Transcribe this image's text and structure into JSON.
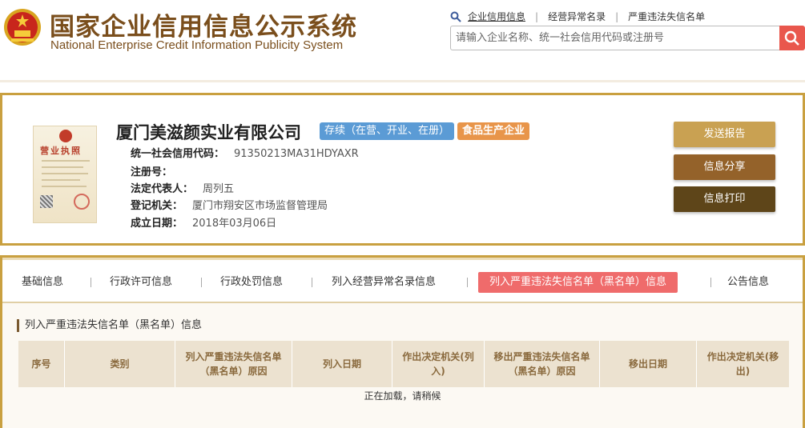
{
  "header": {
    "title_cn": "国家企业信用信息公示系统",
    "title_en": "National Enterprise Credit Information Publicity System",
    "links": [
      "企业信用信息",
      "经营异常名录",
      "严重违法失信名单"
    ],
    "search_placeholder": "请输入企业名称、统一社会信用代码或注册号"
  },
  "license": {
    "title": "营业执照"
  },
  "company": {
    "name": "厦门美滋颜实业有限公司",
    "status": "存续（在营、开业、在册）",
    "tag": "食品生产企业",
    "fields": [
      {
        "label": "统一社会信用代码：",
        "value": "91350213MA31HDYAXR"
      },
      {
        "label": "注册号：",
        "value": ""
      },
      {
        "label": "法定代表人：",
        "value": "周列五"
      },
      {
        "label": "登记机关：",
        "value": "厦门市翔安区市场监督管理局"
      },
      {
        "label": "成立日期：",
        "value": "2018年03月06日"
      }
    ]
  },
  "actions": {
    "report": "发送报告",
    "share": "信息分享",
    "print": "信息打印"
  },
  "tabs": [
    {
      "label": "基础信息"
    },
    {
      "label": "行政许可信息"
    },
    {
      "label": "行政处罚信息"
    },
    {
      "label": "列入经营异常名录信息"
    },
    {
      "label": "列入严重违法失信名单（黑名单）信息"
    },
    {
      "label": "公告信息"
    }
  ],
  "section": {
    "title": "列入严重违法失信名单（黑名单）信息",
    "columns": [
      "序号",
      "类别",
      "列入严重违法失信名单（黑名单）原因",
      "列入日期",
      "作出决定机关(列入)",
      "移出严重违法失信名单（黑名单）原因",
      "移出日期",
      "作出决定机关(移出)"
    ],
    "loading": "正在加载，请稍候"
  },
  "colors": {
    "brand_gold": "#c9a040",
    "brand_brown": "#7a4e1c",
    "active_tab": "#ef6b6b",
    "status_blue": "#5b9bd5",
    "tag_orange": "#e8954a"
  },
  "icons": {
    "emblem": "national-emblem-icon",
    "search": "search-icon"
  }
}
